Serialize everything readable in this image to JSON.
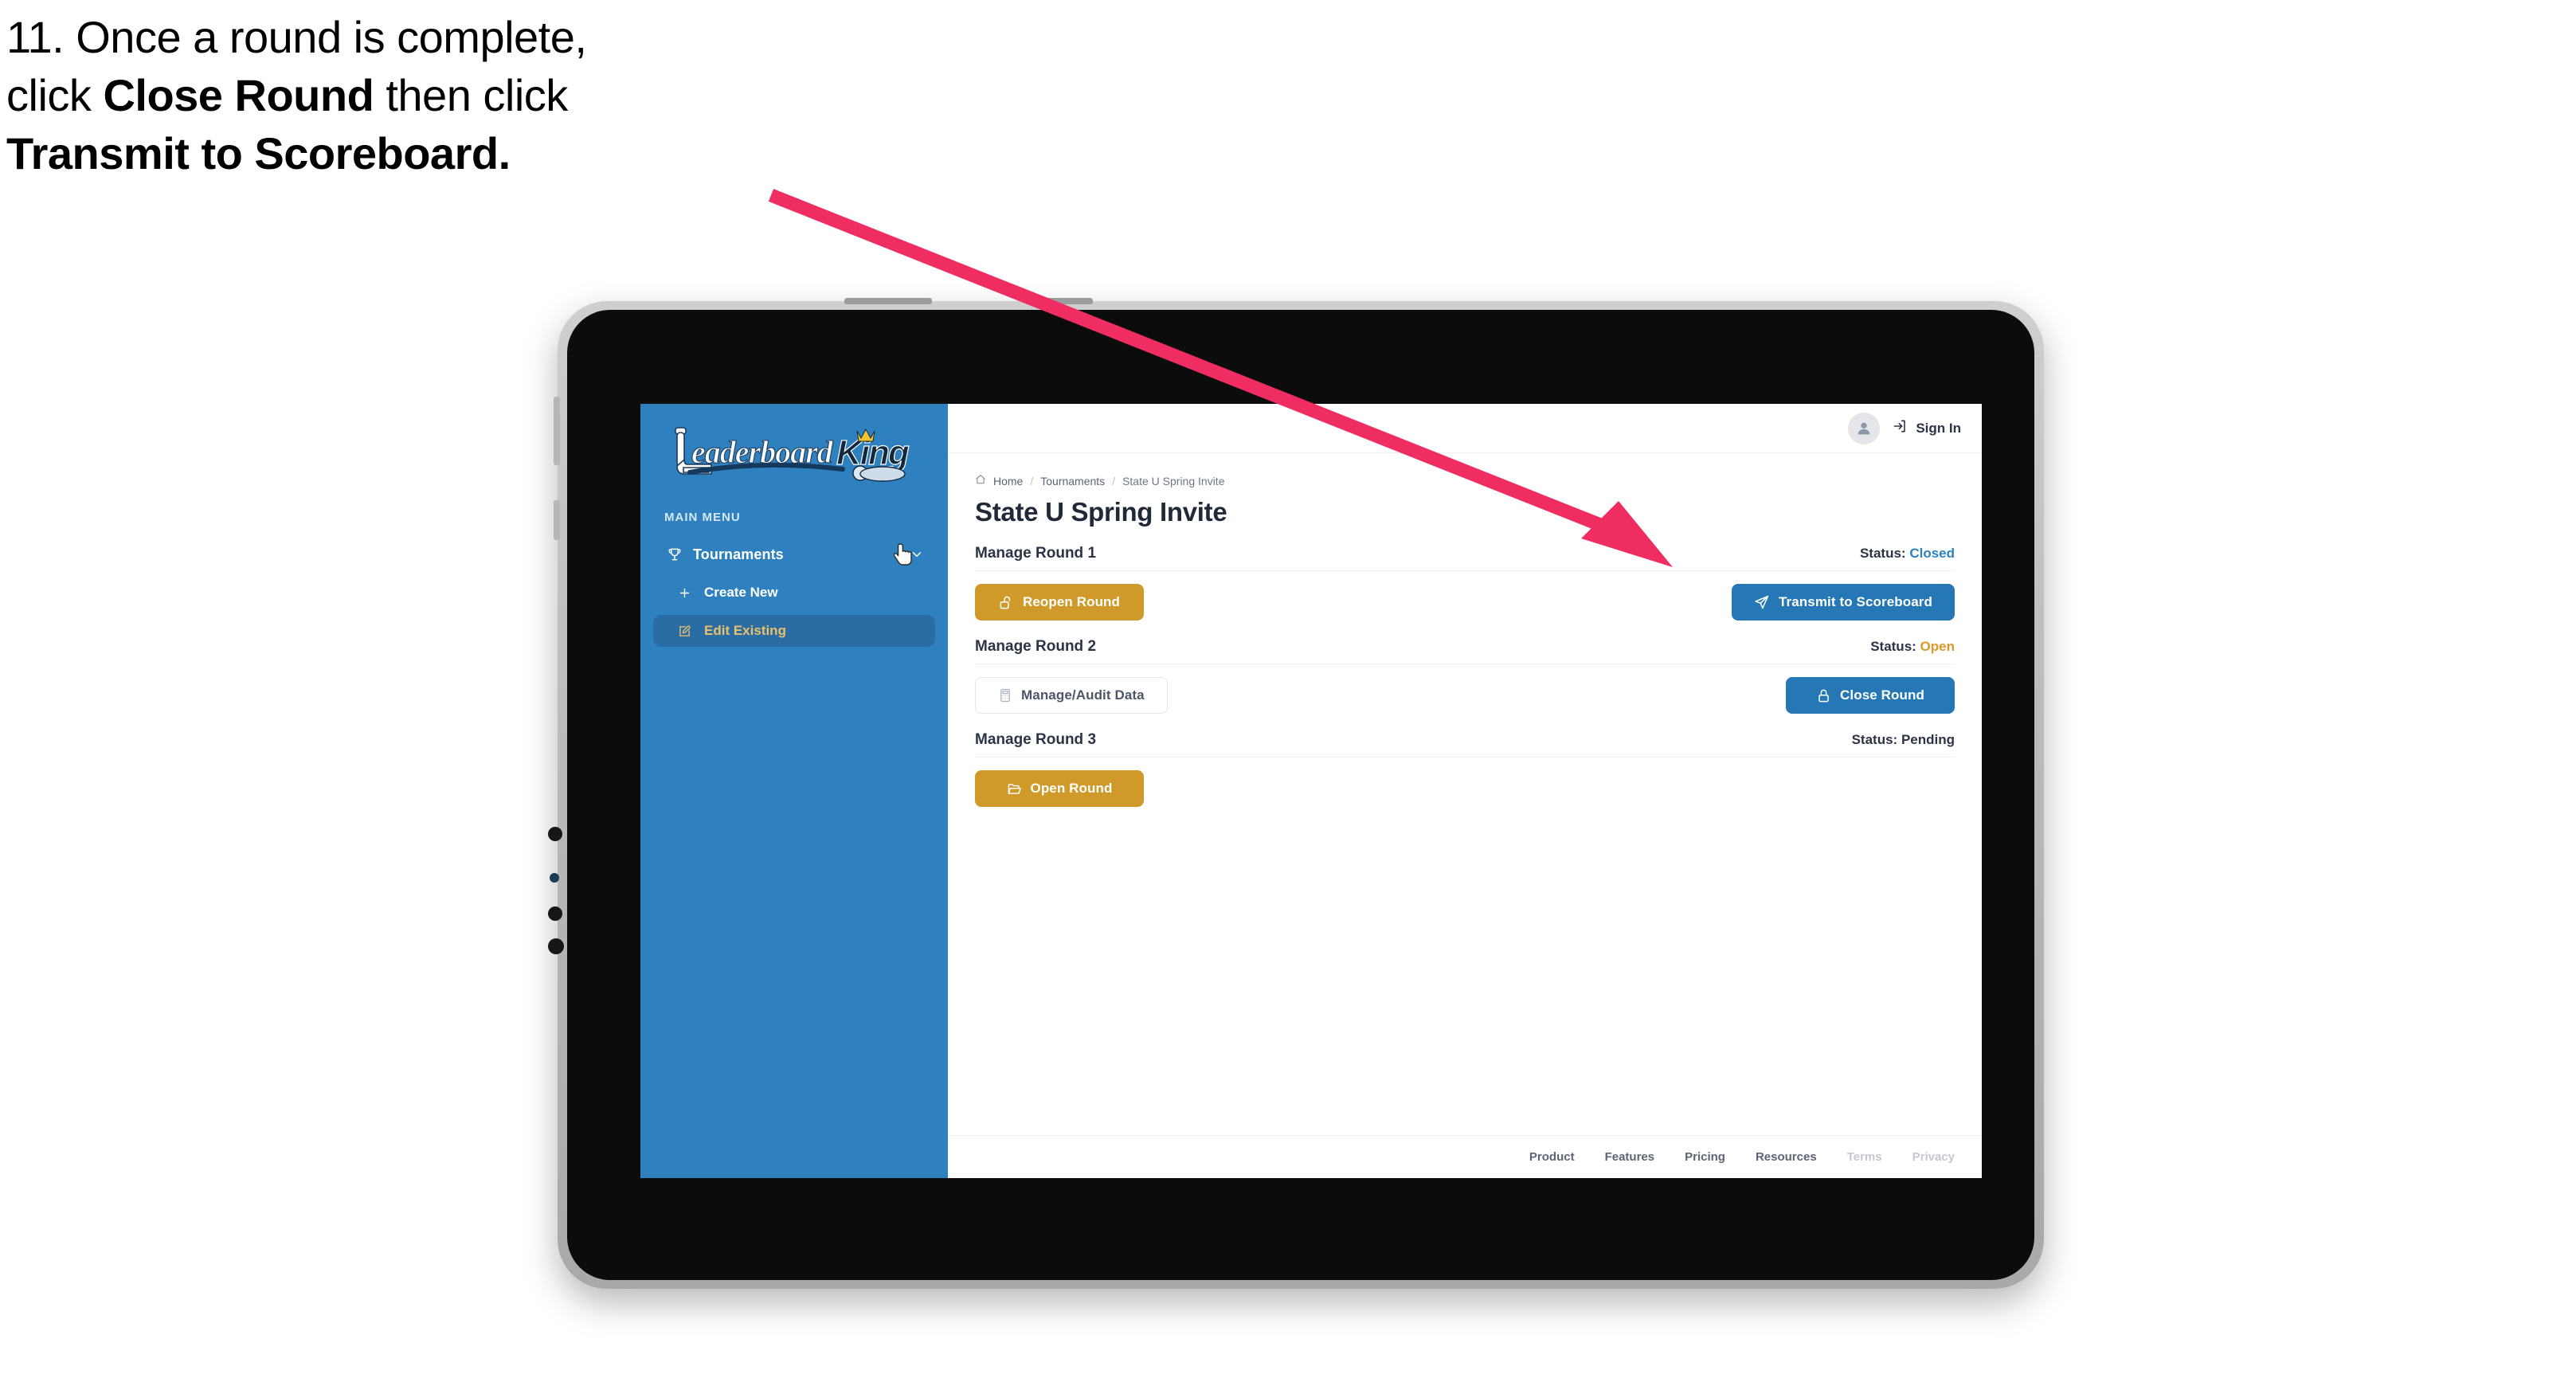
{
  "caption": {
    "line1_plain": "11. Once a round is complete,",
    "line2_pre": "click ",
    "line2_bold": "Close Round",
    "line2_post": " then click",
    "line3_bold": "Transmit to Scoreboard."
  },
  "colors": {
    "accent_blue": "#2577b5",
    "sidebar_blue": "#2f80bf",
    "gold": "#cf9a2a",
    "status_open": "#d99a28",
    "status_closed": "#2f80bf",
    "arrow_pink": "#ef2d63",
    "active_item_text": "#e8c16a"
  },
  "sidebar": {
    "logo": {
      "word1": "Leaderboard",
      "word2": "King",
      "icon": "golf-putter-crown-logo"
    },
    "section_label": "MAIN MENU",
    "items": [
      {
        "label": "Tournaments",
        "icon": "trophy-icon",
        "chevron": "chevron-down-icon",
        "active": false
      },
      {
        "label": "Create New",
        "icon": "plus-icon",
        "active": false
      },
      {
        "label": "Edit Existing",
        "icon": "pencil-square-icon",
        "active": true
      }
    ]
  },
  "topbar": {
    "avatar_icon": "user-avatar-icon",
    "signin_icon": "login-arrow-icon",
    "signin_label": "Sign In"
  },
  "breadcrumb": {
    "home_icon": "home-icon",
    "items": [
      "Home",
      "Tournaments",
      "State U Spring Invite"
    ],
    "separator": "/"
  },
  "page": {
    "title": "State U Spring Invite"
  },
  "rounds": [
    {
      "name": "Manage Round 1",
      "status_label": "Status:",
      "status_value": "Closed",
      "status_kind": "closed",
      "left_button": {
        "label": "Reopen Round",
        "icon": "unlock-icon",
        "style": "gold"
      },
      "right_button": {
        "label": "Transmit to Scoreboard",
        "icon": "paper-plane-icon",
        "style": "blue"
      }
    },
    {
      "name": "Manage Round 2",
      "status_label": "Status:",
      "status_value": "Open",
      "status_kind": "open",
      "left_button": {
        "label": "Manage/Audit Data",
        "icon": "calculator-icon",
        "style": "ghost"
      },
      "right_button": {
        "label": "Close Round",
        "icon": "lock-icon",
        "style": "blue"
      }
    },
    {
      "name": "Manage Round 3",
      "status_label": "Status:",
      "status_value": "Pending",
      "status_kind": "pending",
      "left_button": {
        "label": "Open Round",
        "icon": "folder-open-icon",
        "style": "gold"
      },
      "right_button": null
    }
  ],
  "footer": {
    "links": [
      {
        "label": "Product",
        "muted": false
      },
      {
        "label": "Features",
        "muted": false
      },
      {
        "label": "Pricing",
        "muted": false
      },
      {
        "label": "Resources",
        "muted": false
      },
      {
        "label": "Terms",
        "muted": true
      },
      {
        "label": "Privacy",
        "muted": true
      }
    ]
  },
  "annotation": {
    "arrow_icon": "annotation-arrow-icon",
    "cursor_icon": "pointing-hand-cursor-icon"
  }
}
